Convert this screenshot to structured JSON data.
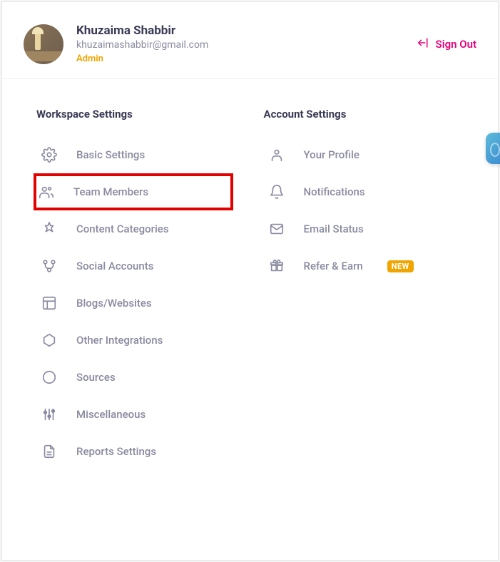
{
  "user": {
    "name": "Khuzaima Shabbir",
    "email": "khuzaimashabbir@gmail.com",
    "role": "Admin"
  },
  "signout_label": "Sign Out",
  "workspace": {
    "title": "Workspace Settings",
    "items": [
      {
        "label": "Basic Settings"
      },
      {
        "label": "Team Members"
      },
      {
        "label": "Content Categories"
      },
      {
        "label": "Social Accounts"
      },
      {
        "label": "Blogs/Websites"
      },
      {
        "label": "Other Integrations"
      },
      {
        "label": "Sources"
      },
      {
        "label": "Miscellaneous"
      },
      {
        "label": "Reports Settings"
      }
    ]
  },
  "account": {
    "title": "Account Settings",
    "items": [
      {
        "label": "Your Profile"
      },
      {
        "label": "Notifications"
      },
      {
        "label": "Email Status"
      },
      {
        "label": "Refer & Earn",
        "badge": "NEW"
      }
    ]
  }
}
